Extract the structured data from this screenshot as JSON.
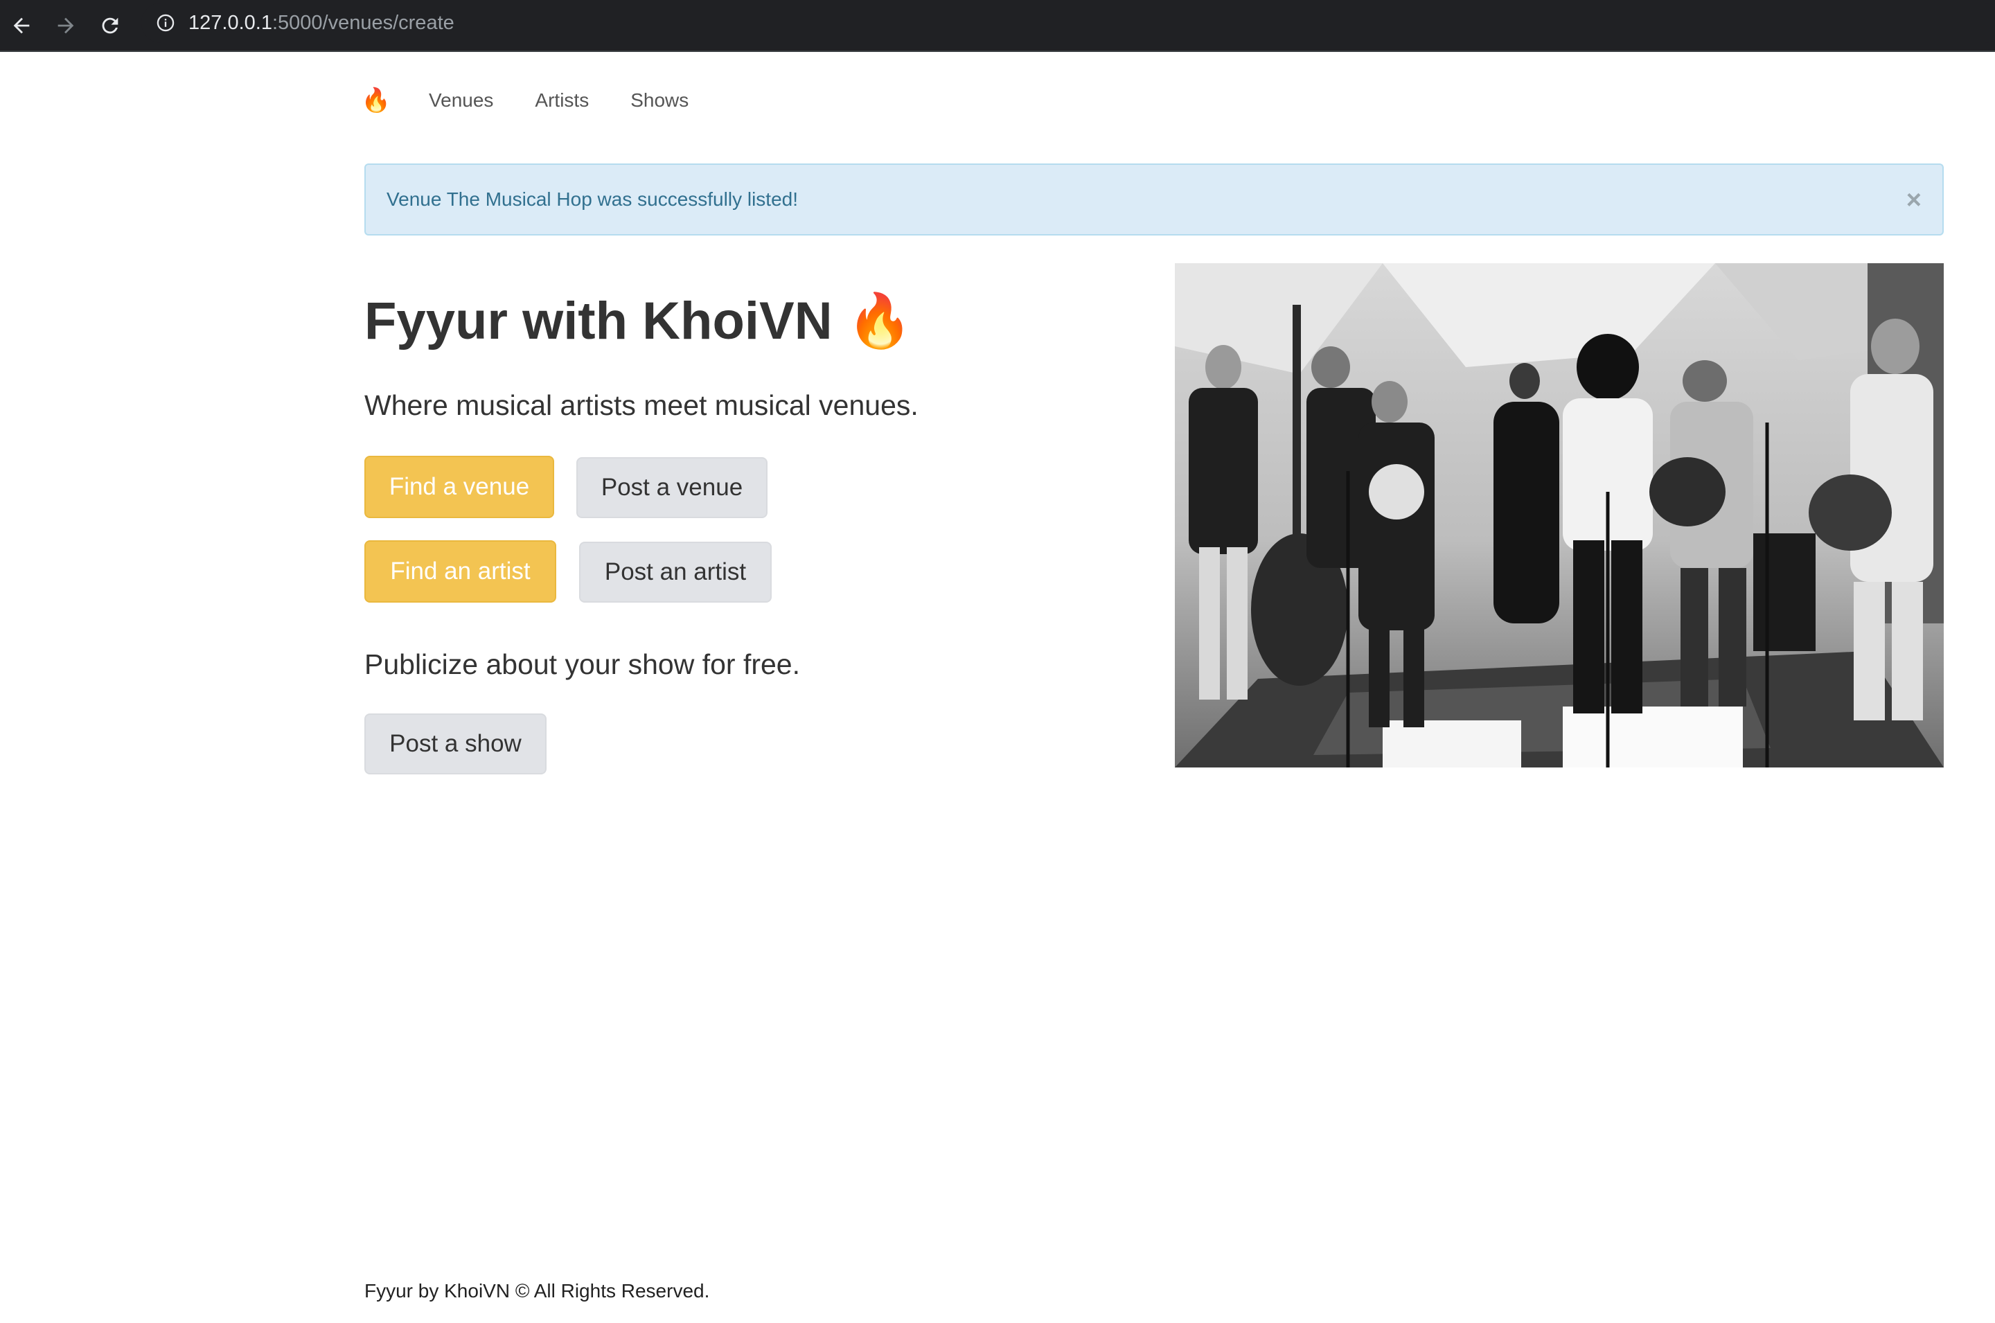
{
  "browser": {
    "url_host": "127.0.0.1",
    "url_rest": ":5000/venues/create",
    "back_icon": "arrow-left-icon",
    "forward_icon": "arrow-right-icon",
    "reload_icon": "reload-icon",
    "info_icon": "info-icon"
  },
  "nav": {
    "brand": "🔥",
    "links": [
      "Venues",
      "Artists",
      "Shows"
    ]
  },
  "alert": {
    "message": "Venue The Musical Hop was successfully listed!",
    "close": "×"
  },
  "hero": {
    "title": "Fyyur with KhoiVN 🔥",
    "tagline": "Where musical artists meet musical venues.",
    "buttons": {
      "find_venue": "Find a venue",
      "post_venue": "Post a venue",
      "find_artist": "Find an artist",
      "post_artist": "Post an artist",
      "post_show": "Post a show"
    },
    "tagline2": "Publicize about your show for free."
  },
  "footer": {
    "text": "Fyyur by KhoiVN © All Rights Reserved."
  },
  "colors": {
    "warning": "#f3c452",
    "default_btn": "#e1e3e7",
    "alert_bg": "#dbebf7",
    "alert_text": "#31708f"
  }
}
